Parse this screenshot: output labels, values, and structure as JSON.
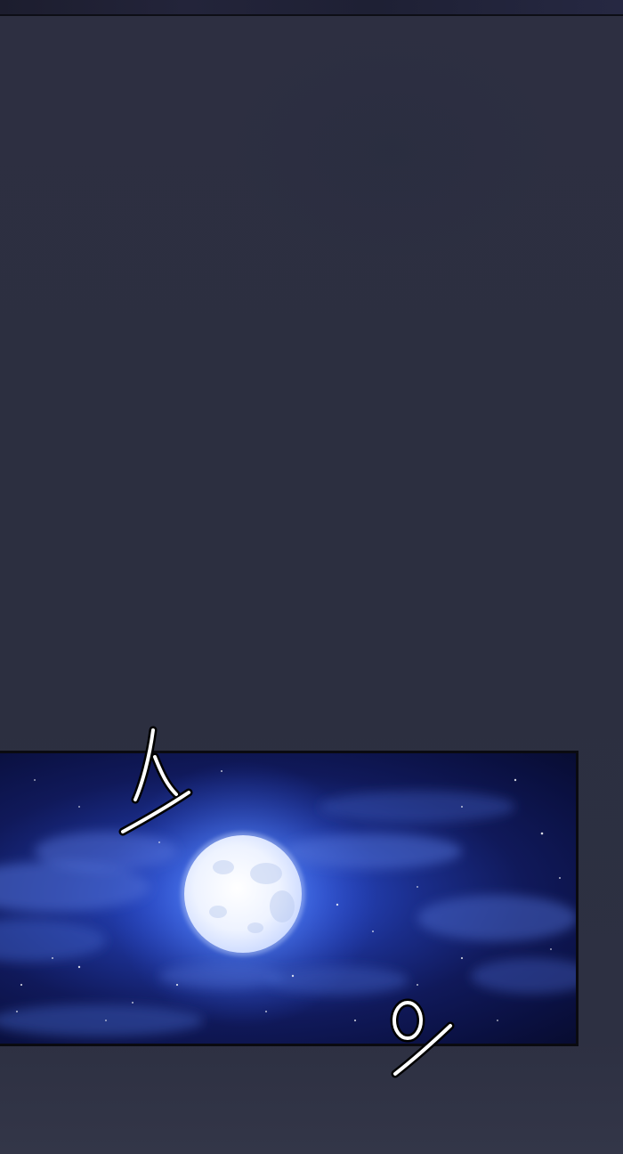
{
  "panel": {
    "scene": "night-sky-full-moon"
  },
  "sfx": {
    "first": "ㅅ",
    "second": "ㅇ"
  },
  "colors": {
    "background": "#2c2f40",
    "sky_deep": "#0a1040",
    "sky_glow": "#3a64e8",
    "moon": "#f2f6ff",
    "panel_border": "#0a0a10"
  }
}
